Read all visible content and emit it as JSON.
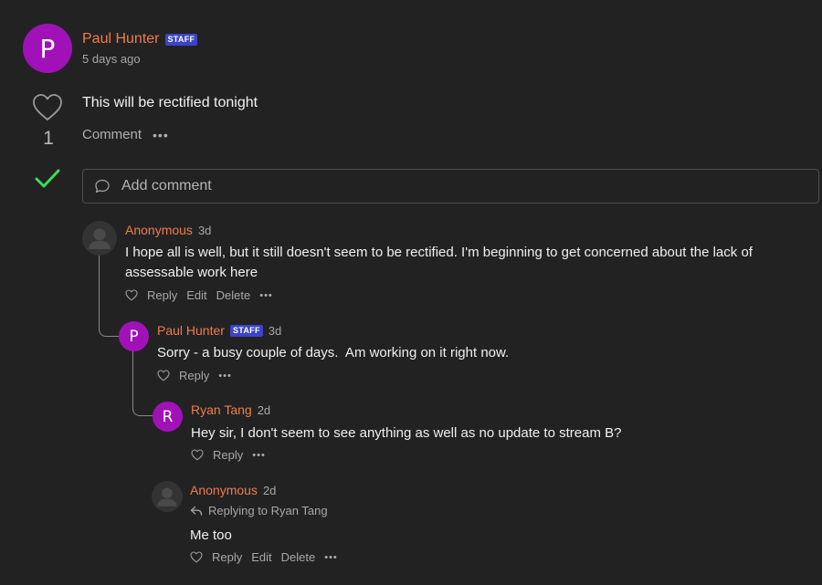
{
  "post": {
    "author": "Paul Hunter",
    "avatar_letter": "P",
    "badge": "STAFF",
    "time": "5 days ago",
    "body": "This will be rectified tonight",
    "like_count": "1",
    "comment_label": "Comment",
    "more": "•••"
  },
  "add_comment": {
    "placeholder": "Add comment"
  },
  "comments": [
    {
      "author": "Anonymous",
      "time": "3d",
      "body": "I hope all is well, but it still doesn't seem to be rectified. I'm beginning to get concerned about the lack of assessable work here",
      "reply": "Reply",
      "edit": "Edit",
      "delete": "Delete",
      "more": "•••"
    },
    {
      "author": "Paul Hunter",
      "avatar_letter": "P",
      "badge": "STAFF",
      "time": "3d",
      "body": "Sorry - a busy couple of days.  Am working on it right now.",
      "reply": "Reply",
      "more": "•••"
    },
    {
      "author": "Ryan Tang",
      "avatar_letter": "R",
      "time": "2d",
      "body": "Hey sir, I don't seem to see anything as well as no update to stream B?",
      "reply": "Reply",
      "more": "•••"
    },
    {
      "author": "Anonymous",
      "time": "2d",
      "replying_to": "Replying to Ryan Tang",
      "body": "Me too",
      "reply": "Reply",
      "edit": "Edit",
      "delete": "Delete",
      "more": "•••"
    }
  ],
  "colors": {
    "background": "#222222",
    "author_name": "#f07c4a",
    "avatar": "#a012b8",
    "staff_badge": "#3b44c8",
    "accepted_check": "#3ddc5a"
  },
  "icons": [
    "heart-icon",
    "check-icon",
    "speech-bubble-icon",
    "reply-arrow-icon",
    "anonymous-user-icon"
  ]
}
